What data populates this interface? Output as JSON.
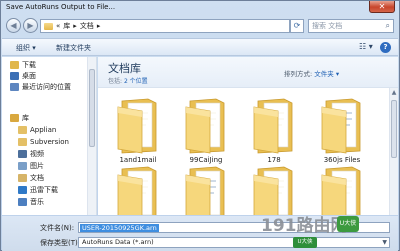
{
  "window": {
    "title": "Save AutoRuns Output to File...",
    "close_glyph": "✕"
  },
  "address": {
    "back_glyph": "◀",
    "forward_glyph": "▶",
    "path_sep": "«",
    "path": [
      "库",
      "文档"
    ],
    "path_arrow": "▸",
    "refresh_glyph": "⟳",
    "search_placeholder": "搜索 文档",
    "search_glyph": "⌕"
  },
  "toolbar": {
    "organize": "组织 ▾",
    "new_folder": "新建文件夹",
    "view_glyph": "☷ ▾",
    "help_glyph": "?"
  },
  "nav": {
    "items": [
      {
        "label": "下载",
        "icon": "download-folder-icon",
        "color": "#e0b74c"
      },
      {
        "label": "桌面",
        "icon": "desktop-icon",
        "color": "#3b6fb5"
      },
      {
        "label": "最近访问的位置",
        "icon": "recent-places-icon",
        "color": "#5e86c0"
      },
      {
        "label": "库",
        "icon": "library-icon",
        "color": "#d9a83f"
      },
      {
        "label": "Applian",
        "icon": "library-applian-icon",
        "color": "#e4c066"
      },
      {
        "label": "Subversion",
        "icon": "library-subversion-icon",
        "color": "#e4c066"
      },
      {
        "label": "视频",
        "icon": "video-library-icon",
        "color": "#4d6f9b"
      },
      {
        "label": "图片",
        "icon": "pictures-library-icon",
        "color": "#7a9fc8"
      },
      {
        "label": "文档",
        "icon": "documents-library-icon",
        "color": "#d6b468"
      },
      {
        "label": "迅雷下载",
        "icon": "thunder-download-icon",
        "color": "#2f79c7"
      },
      {
        "label": "音乐",
        "icon": "music-library-icon",
        "color": "#4d7fc0"
      }
    ]
  },
  "library": {
    "title": "文档库",
    "subtitle_prefix": "包括:",
    "subtitle_link": "2 个位置",
    "arrange_label": "排列方式:",
    "arrange_value": "文件夹 ▾"
  },
  "folders": [
    {
      "name": "1and1mail"
    },
    {
      "name": "99CaiJing"
    },
    {
      "name": "178"
    },
    {
      "name": "360js Files"
    },
    {
      "name": ""
    },
    {
      "name": ""
    },
    {
      "name": ""
    },
    {
      "name": ""
    }
  ],
  "save": {
    "filename_label": "文件名(N):",
    "filename_value": "USER-20150925GK.arn",
    "filetype_label": "保存类型(T):",
    "filetype_value": "AutoRuns Data (*.arn)"
  },
  "watermark": {
    "text": "191路由网",
    "badge": "U大侠",
    "tag": "U大侠"
  },
  "colors": {
    "accent": "#3f8ee0",
    "folder": "#f1cf6e",
    "close": "#c8452b"
  }
}
